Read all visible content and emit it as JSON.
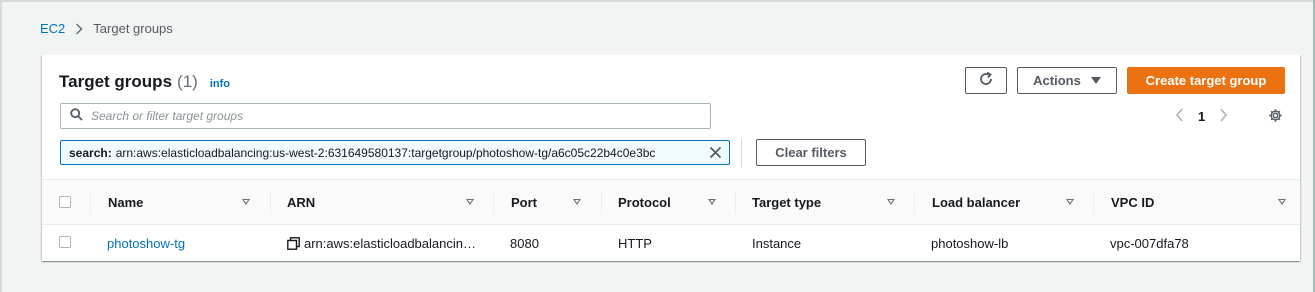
{
  "breadcrumb": {
    "root": "EC2",
    "current": "Target groups"
  },
  "header": {
    "title": "Target groups",
    "count": "(1)",
    "info": "info"
  },
  "toolbar": {
    "actions_label": "Actions",
    "create_label": "Create target group",
    "clear_filters_label": "Clear filters"
  },
  "search": {
    "placeholder": "Search or filter target groups"
  },
  "filter_chip": {
    "label": "search:",
    "value": "arn:aws:elasticloadbalancing:us-west-2:631649580137:targetgroup/photoshow-tg/a6c05c22b4c0e3bc"
  },
  "pagination": {
    "current_page": "1"
  },
  "table": {
    "columns": [
      "Name",
      "ARN",
      "Port",
      "Protocol",
      "Target type",
      "Load balancer",
      "VPC ID"
    ],
    "rows": [
      {
        "name": "photoshow-tg",
        "arn": "arn:aws:elasticloadbalancin…",
        "port": "8080",
        "protocol": "HTTP",
        "target_type": "Instance",
        "load_balancer": "photoshow-lb",
        "vpc_id": "vpc-007dfa78"
      }
    ]
  },
  "colors": {
    "link": "#0073bb",
    "primary_button": "#ec7211",
    "chip_border": "#0073bb"
  },
  "icons": [
    "chevron-right-icon",
    "refresh-icon",
    "caret-down-icon",
    "search-icon",
    "close-icon",
    "chevron-left-icon",
    "gear-icon",
    "sort-icon",
    "copy-icon"
  ]
}
